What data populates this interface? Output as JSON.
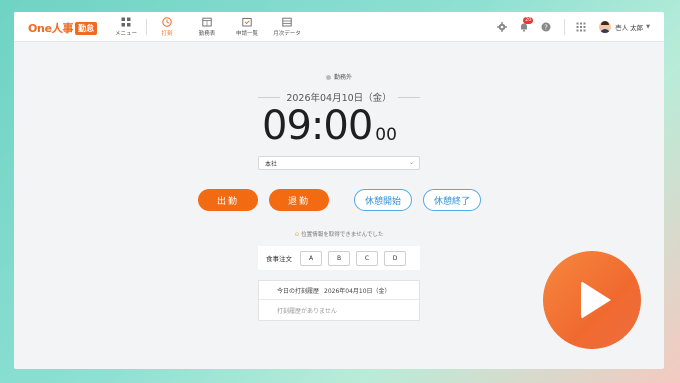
{
  "app": {
    "logo_text": "One人事",
    "logo_badge": "勤怠"
  },
  "nav": {
    "items": [
      {
        "label": "メニュー",
        "icon": "grid-icon"
      },
      {
        "label": "打刻",
        "icon": "clock-icon",
        "active": true
      },
      {
        "label": "勤務表",
        "icon": "calendar-table-icon"
      },
      {
        "label": "申請一覧",
        "icon": "request-list-icon"
      },
      {
        "label": "月次データ",
        "icon": "monthly-data-icon"
      }
    ]
  },
  "header_right": {
    "notification_count": "20",
    "user_name": "壱人 太郎",
    "icons": [
      "gear-icon",
      "bell-icon",
      "help-icon",
      "apps-grid-icon"
    ]
  },
  "punch": {
    "status": "勤務外",
    "date": "2026年04月10日（金）",
    "time_hm": "09:00",
    "time_ss": "00",
    "location_value": "本社",
    "buttons": {
      "clock_in": "出勤",
      "clock_out": "退勤",
      "break_start": "休憩開始",
      "break_end": "休憩終了"
    },
    "geo_message": "位置情報を取得できませんでした"
  },
  "meal_order": {
    "label": "食事注文",
    "options": [
      "A",
      "B",
      "C",
      "D"
    ]
  },
  "history": {
    "title": "今日の打刻履歴",
    "date": "2026年04月10日（金）",
    "empty": "打刻履歴がありません"
  },
  "colors": {
    "accent": "#f26b12",
    "outline_blue": "#2f8fd6"
  },
  "overlay": {
    "icon": "play-icon"
  }
}
